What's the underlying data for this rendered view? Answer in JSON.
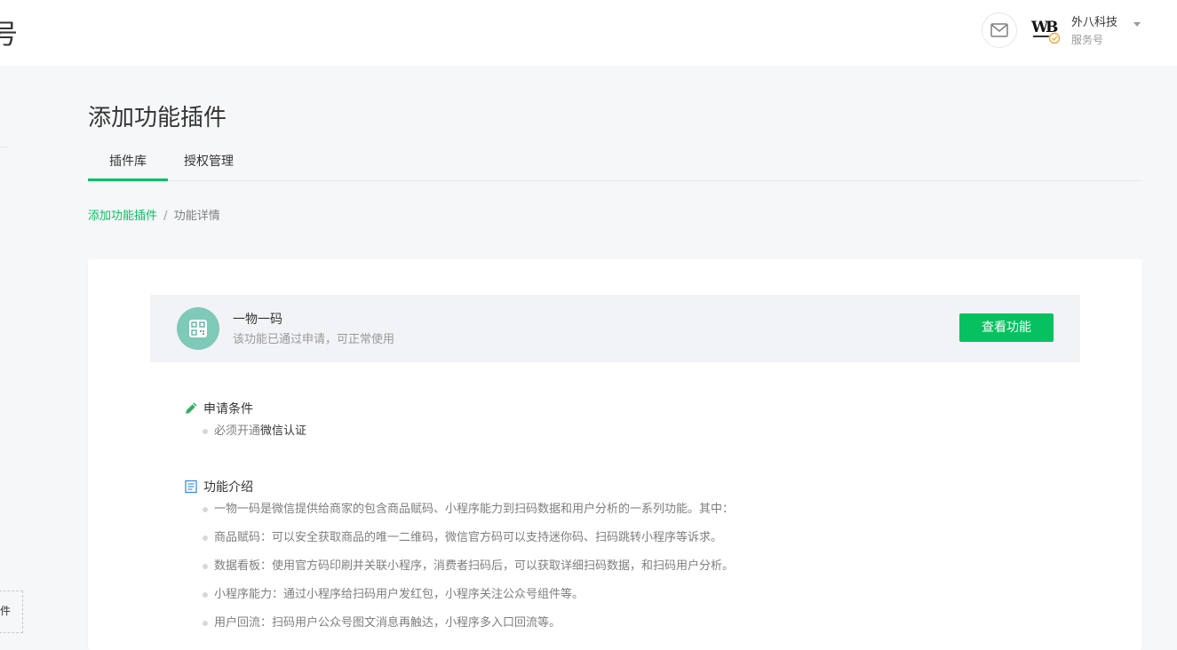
{
  "header": {
    "brand_fragment": "号",
    "account_name": "外八科技",
    "account_type": "服务号"
  },
  "sidebar": {
    "stub_label": "件"
  },
  "page": {
    "title": "添加功能插件",
    "tabs": [
      {
        "label": "插件库",
        "active": true
      },
      {
        "label": "授权管理",
        "active": false
      }
    ],
    "breadcrumb": {
      "parent": "添加功能插件",
      "separator": "/",
      "current": "功能详情"
    }
  },
  "feature": {
    "name": "一物一码",
    "status": "该功能已通过申请，可正常使用",
    "action_label": "查看功能",
    "icon": "qrcode-icon"
  },
  "requirements": {
    "title": "申请条件",
    "items": [
      {
        "prefix": "必须开通",
        "highlight": "微信认证"
      }
    ]
  },
  "intro": {
    "title": "功能介绍",
    "items": [
      "一物一码是微信提供给商家的包含商品赋码、小程序能力到扫码数据和用户分析的一系列功能。其中：",
      "商品赋码：可以安全获取商品的唯一二维码，微信官方码可以支持迷你码、扫码跳转小程序等诉求。",
      "数据看板：使用官方码印刷并关联小程序，消费者扫码后，可以获取详细扫码数据，和扫码用户分析。",
      "小程序能力：通过小程序给扫码用户发红包，小程序关注公众号组件等。",
      "用户回流：扫码用户公众号图文消息再触达，小程序多入口回流等。"
    ]
  },
  "colors": {
    "accent": "#07c160",
    "feature_icon_bg": "#7ec9b8",
    "page_bg": "#f6f7f9"
  }
}
